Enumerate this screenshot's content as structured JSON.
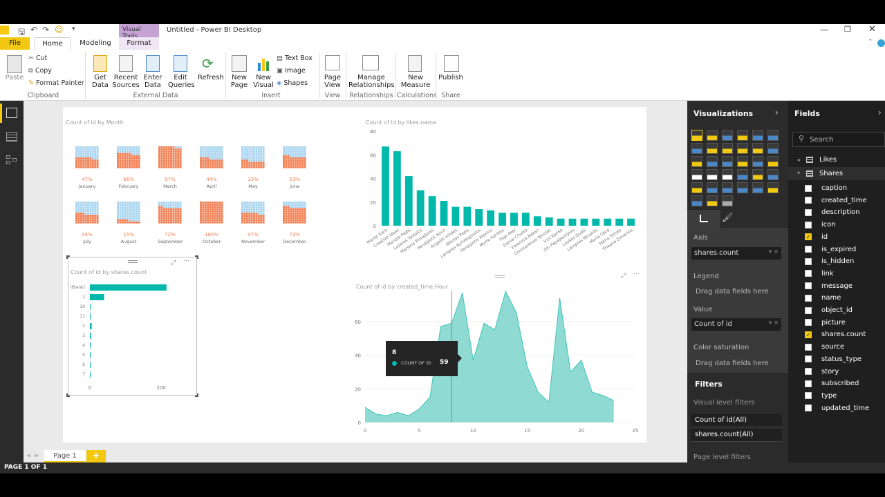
{
  "window": {
    "title": "Untitled - Power BI Desktop",
    "context_tab": "Visual Tools"
  },
  "tabs": [
    "File",
    "Home",
    "Modeling",
    "Format"
  ],
  "ribbon": {
    "clipboard": {
      "paste": "Paste",
      "cut": "Cut",
      "copy": "Copy",
      "format_painter": "Format Painter",
      "group": "Clipboard"
    },
    "external": {
      "get_data": "Get\nData",
      "recent": "Recent\nSources",
      "enter": "Enter\nData",
      "edit": "Edit\nQueries",
      "refresh": "Refresh",
      "group": "External Data"
    },
    "insert": {
      "new_page": "New\nPage",
      "new_visual": "New\nVisual",
      "text_box": "Text Box",
      "image": "Image",
      "shapes": "Shapes",
      "group": "Insert"
    },
    "view": {
      "page_view": "Page\nView",
      "group": "View"
    },
    "relationships": {
      "manage": "Manage\nRelationships",
      "group": "Relationships"
    },
    "calculations": {
      "new_measure": "New\nMeasure",
      "group": "Calculations"
    },
    "share": {
      "publish": "Publish",
      "group": "Share"
    }
  },
  "waffle": {
    "title": "Count of id by Month",
    "items": [
      {
        "month": "January",
        "pct": "47%",
        "v": 0.47
      },
      {
        "month": "February",
        "pct": "66%",
        "v": 0.66
      },
      {
        "month": "March",
        "pct": "97%",
        "v": 0.97
      },
      {
        "month": "April",
        "pct": "44%",
        "v": 0.44
      },
      {
        "month": "May",
        "pct": "33%",
        "v": 0.33
      },
      {
        "month": "June",
        "pct": "53%",
        "v": 0.53
      },
      {
        "month": "July",
        "pct": "44%",
        "v": 0.44
      },
      {
        "month": "August",
        "pct": "15%",
        "v": 0.15
      },
      {
        "month": "September",
        "pct": "72%",
        "v": 0.72
      },
      {
        "month": "October",
        "pct": "100%",
        "v": 1.0
      },
      {
        "month": "November",
        "pct": "47%",
        "v": 0.47
      },
      {
        "month": "December",
        "pct": "73%",
        "v": 0.73
      }
    ]
  },
  "chart_data": [
    {
      "type": "bar",
      "title": "Count of id by likes.name",
      "ylim": [
        0,
        80
      ],
      "yticks": [
        0,
        20,
        40,
        60,
        80
      ],
      "categories": [
        "Marito Karo",
        "Creative Ideas",
        "Mariolo Pepis",
        "Lazaros Yastakis",
        "Mariana Pintadores",
        "Panagiotis Kouri",
        "Angeliki Vilides",
        "Nikolas Pepis",
        "Lampros Kyriakopoulos",
        "Panagiotis Alexiou",
        "Myrto Kariliou",
        "Popi Pepi",
        "Daniel Chaika",
        "Eleonora Bakari",
        "Constantinos Nicolas",
        "Irini Karisa",
        "Jim Papageorgiou",
        "Loukas Duals",
        "Lampros Minaklis",
        "Maria Obra",
        "Maria Simao",
        "Theano Zimariou"
      ],
      "values": [
        67,
        63,
        42,
        30,
        25,
        21,
        16,
        16,
        14,
        13,
        11,
        11,
        11,
        8,
        7,
        6,
        6,
        6,
        6,
        6,
        6,
        6
      ]
    },
    {
      "type": "bar",
      "orientation": "horizontal",
      "title": "Count of id by shares.count",
      "categories": [
        "(Blank)",
        "1",
        "10",
        "11",
        "2",
        "3",
        "4",
        "5",
        "6",
        "7"
      ],
      "values": [
        215,
        40,
        1,
        1,
        5,
        3,
        1,
        2,
        2,
        1
      ],
      "xticks": [
        0,
        200
      ],
      "xlim": [
        0,
        260
      ]
    },
    {
      "type": "area",
      "title": "Count of id by created_time.Hour",
      "xlim": [
        0,
        25
      ],
      "ylim": [
        0,
        80
      ],
      "xticks": [
        0,
        5,
        10,
        15,
        20,
        25
      ],
      "yticks": [
        0,
        20,
        40,
        60,
        80
      ],
      "x": [
        0,
        1,
        2,
        3,
        4,
        5,
        6,
        7,
        8,
        9,
        10,
        11,
        12,
        13,
        14,
        15,
        16,
        17,
        18,
        19,
        20,
        21,
        22,
        23
      ],
      "y": [
        9,
        5,
        4,
        6,
        4,
        8,
        15,
        57,
        59,
        77,
        37,
        59,
        55,
        78,
        65,
        33,
        18,
        12,
        74,
        30,
        37,
        18,
        16,
        13
      ],
      "tooltip": {
        "x": "8",
        "label": "COUNT OF ID",
        "value": "59"
      }
    }
  ],
  "viz_pane": {
    "title": "Visualizations",
    "axis_label": "Axis",
    "axis_field": "shares.count",
    "legend_label": "Legend",
    "legend_hint": "Drag data fields here",
    "value_label": "Value",
    "value_field": "Count of id",
    "color_label": "Color saturation",
    "color_hint": "Drag data fields here",
    "filters_title": "Filters",
    "visual_filters": "Visual level filters",
    "filter1": "Count of id(All)",
    "filter2": "shares.count(All)",
    "page_filters": "Page level filters"
  },
  "fields_pane": {
    "title": "Fields",
    "search": "Search",
    "tables": [
      "Likes",
      "Shares"
    ],
    "fields": [
      {
        "n": "caption",
        "c": false
      },
      {
        "n": "created_time",
        "c": false
      },
      {
        "n": "description",
        "c": false
      },
      {
        "n": "icon",
        "c": false
      },
      {
        "n": "id",
        "c": true
      },
      {
        "n": "is_expired",
        "c": false
      },
      {
        "n": "is_hidden",
        "c": false
      },
      {
        "n": "link",
        "c": false
      },
      {
        "n": "message",
        "c": false
      },
      {
        "n": "name",
        "c": false
      },
      {
        "n": "object_id",
        "c": false
      },
      {
        "n": "picture",
        "c": false
      },
      {
        "n": "shares.count",
        "c": true
      },
      {
        "n": "source",
        "c": false
      },
      {
        "n": "status_type",
        "c": false
      },
      {
        "n": "story",
        "c": false
      },
      {
        "n": "subscribed",
        "c": false
      },
      {
        "n": "type",
        "c": false
      },
      {
        "n": "updated_time",
        "c": false
      }
    ]
  },
  "page_tab": "Page 1",
  "status": "PAGE 1 OF 1",
  "colors": {
    "teal": "#01b8aa",
    "orange": "#f07d50",
    "yellow": "#f2c811"
  }
}
